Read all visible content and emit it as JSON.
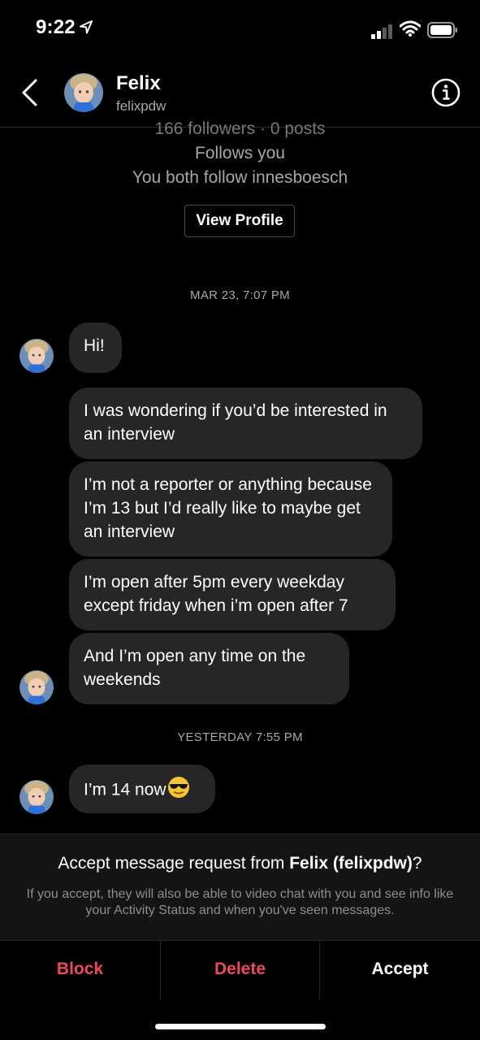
{
  "status_bar": {
    "time": "9:22"
  },
  "header": {
    "name": "Felix",
    "username": "felixpdw"
  },
  "profile": {
    "stats": "166 followers · 0 posts",
    "follows_you": "Follows you",
    "mutual": "You both follow innesboesch",
    "view_profile_label": "View Profile"
  },
  "conversation": {
    "timestamp_1": "MAR 23, 7:07 PM",
    "messages_1": [
      "Hi!",
      "I was wondering if you’d be interested in an interview",
      "I’m not a reporter or anything because I’m 13 but I’d really like to maybe get an interview",
      "I’m open after 5pm every weekday except friday when i’m open after 7",
      "And I’m open any time on the weekends"
    ],
    "timestamp_2": "YESTERDAY 7:55 PM",
    "message_2": "I’m 14 now"
  },
  "request": {
    "prefix": "Accept message request from ",
    "who": "Felix (felixpdw)",
    "suffix": "?",
    "note": "If you accept, they will also be able to video chat with you and see info like your Activity Status and when you've seen messages."
  },
  "actions": {
    "block": "Block",
    "delete": "Delete",
    "accept": "Accept"
  },
  "colors": {
    "background": "#000000",
    "bubble": "#262626",
    "destructive": "#ed4956",
    "secondary_text": "#a8a8a8"
  }
}
